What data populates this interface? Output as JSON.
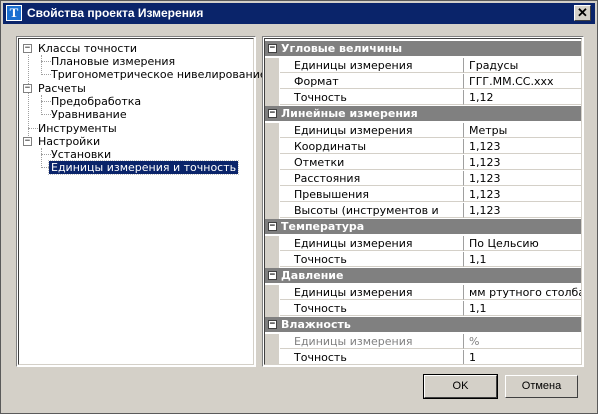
{
  "window": {
    "title": "Свойства проекта Измерения",
    "icon_letter": "T",
    "close_glyph": "✕"
  },
  "tree": {
    "expand_glyph": "−",
    "items": [
      {
        "label": "Классы точности"
      },
      {
        "label": "Плановые измерения"
      },
      {
        "label": "Тригонометрическое нивелирование"
      },
      {
        "label": "Расчеты"
      },
      {
        "label": "Предобработка"
      },
      {
        "label": "Уравнивание"
      },
      {
        "label": "Инструменты"
      },
      {
        "label": "Настройки"
      },
      {
        "label": "Установки"
      },
      {
        "label": "Единицы измерения и точность"
      }
    ],
    "selected": "Единицы измерения и точность"
  },
  "grid": {
    "collapse_glyph": "−",
    "categories": [
      {
        "name": "Угловые величины",
        "rows": [
          {
            "name": "Единицы измерения",
            "value": "Градусы"
          },
          {
            "name": "Формат",
            "value": "ГГГ.ММ.СС.xxx"
          },
          {
            "name": "Точность",
            "value": "1,12"
          }
        ]
      },
      {
        "name": "Линейные измерения",
        "rows": [
          {
            "name": "Единицы измерения",
            "value": "Метры"
          },
          {
            "name": "Координаты",
            "value": "1,123"
          },
          {
            "name": "Отметки",
            "value": "1,123"
          },
          {
            "name": "Расстояния",
            "value": "1,123"
          },
          {
            "name": "Превышения",
            "value": "1,123"
          },
          {
            "name": "Высоты (инструментов и целей)",
            "value": "1,123"
          }
        ]
      },
      {
        "name": "Температура",
        "rows": [
          {
            "name": "Единицы измерения",
            "value": "По Цельсию"
          },
          {
            "name": "Точность",
            "value": "1,1"
          }
        ]
      },
      {
        "name": "Давление",
        "rows": [
          {
            "name": "Единицы измерения",
            "value": "мм ртутного столба"
          },
          {
            "name": "Точность",
            "value": "1,1"
          }
        ]
      },
      {
        "name": "Влажность",
        "rows": [
          {
            "name": "Единицы измерения",
            "value": "%",
            "disabled": true
          },
          {
            "name": "Точность",
            "value": "1"
          }
        ]
      }
    ]
  },
  "buttons": {
    "ok": "OK",
    "cancel": "Отмена"
  },
  "colors": {
    "title_bar": "#0a246a",
    "selection": "#0a246a",
    "category_header": "#808080",
    "dialog_face": "#d4d0c8"
  }
}
